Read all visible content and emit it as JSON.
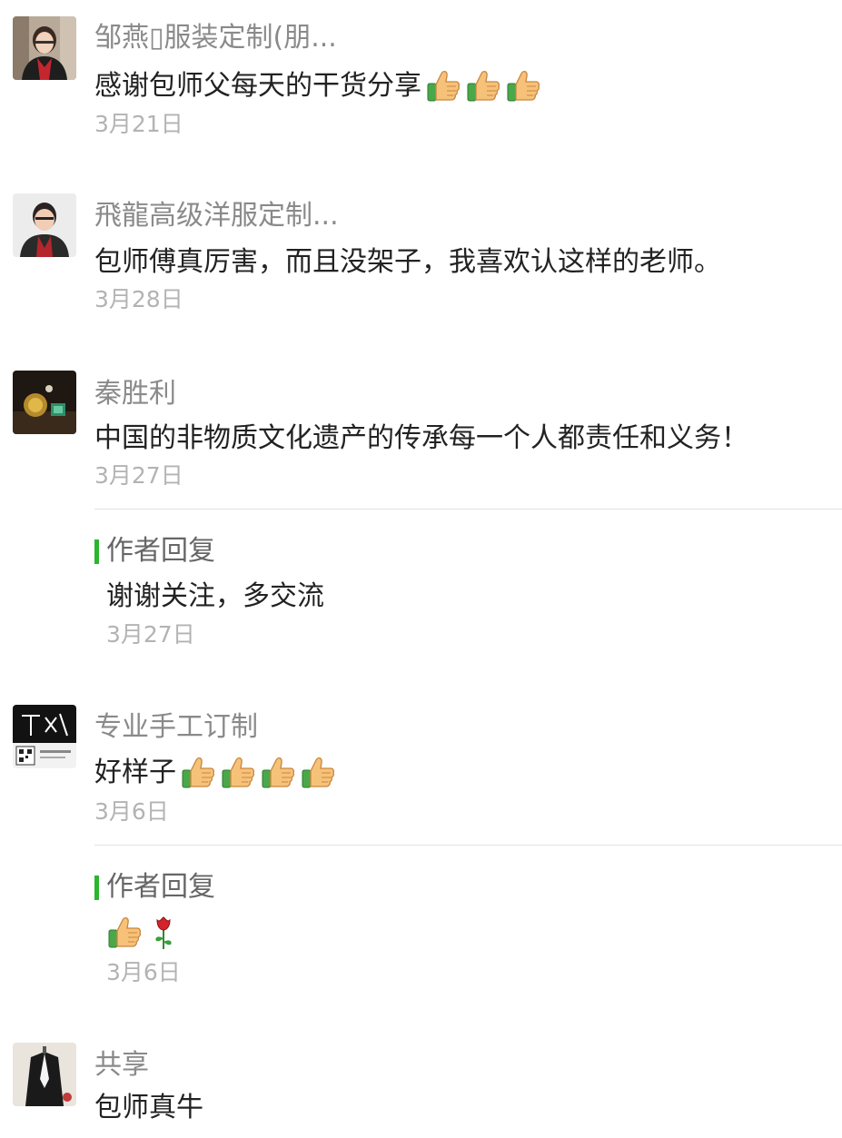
{
  "comments": [
    {
      "name": "邹燕▯服装定制(朋...",
      "text": "感谢包师父每天的干货分享",
      "emoji": [
        "thumbs-up",
        "thumbs-up",
        "thumbs-up"
      ],
      "date": "3月21日",
      "avatar": "avatar-woman-portrait"
    },
    {
      "name": "飛龍高级洋服定制...",
      "text": "包师傅真厉害，而且没架子，我喜欢认这样的老师。",
      "date": "3月28日",
      "avatar": "avatar-man-portrait"
    },
    {
      "name": "秦胜利",
      "text": "中国的非物质文化遗产的传承每一个人都责任和义务！",
      "date": "3月27日",
      "avatar": "avatar-jewelry",
      "reply": {
        "label": "作者回复",
        "text": "谢谢关注，多交流",
        "date": "3月27日"
      }
    },
    {
      "name": "专业手工订制",
      "text": "好样子",
      "emoji": [
        "thumbs-up",
        "thumbs-up",
        "thumbs-up",
        "thumbs-up"
      ],
      "date": "3月6日",
      "avatar": "avatar-logo-qr",
      "reply": {
        "label": "作者回复",
        "text": "",
        "emoji": [
          "thumbs-up",
          "rose"
        ],
        "date": "3月6日"
      }
    },
    {
      "name": "共享",
      "text": "包师真牛",
      "avatar": "avatar-suit"
    }
  ],
  "colors": {
    "name": "#8a8a8a",
    "text": "#222222",
    "date": "#b3b3b3",
    "reply_bar": "#2bb52f",
    "divider": "#e2e2e2"
  }
}
